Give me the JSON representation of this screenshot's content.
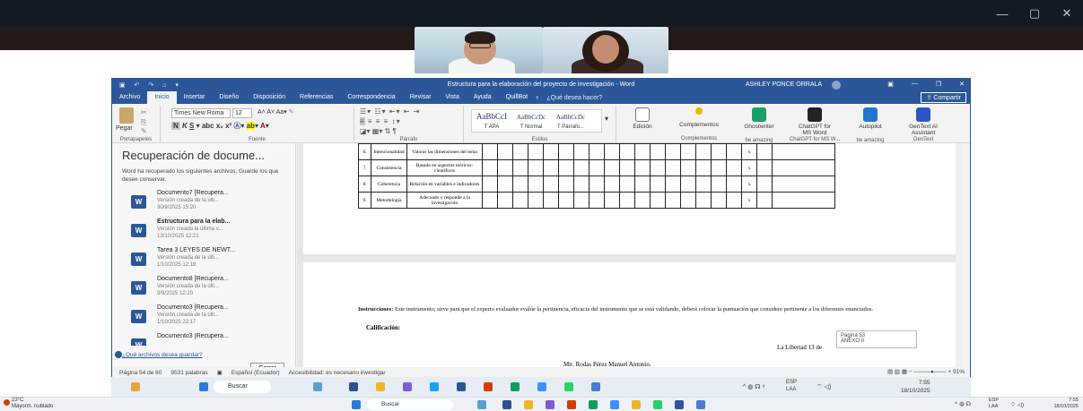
{
  "meeting": {
    "window_controls": [
      "—",
      "▢",
      "✕"
    ]
  },
  "word": {
    "title": "Estructura para la elaboración del proyecto de investigación  -  Word",
    "user": "ASHLEY PONCE ORRALA",
    "user_initials": "AP",
    "tabs": [
      "Archivo",
      "Inicio",
      "Insertar",
      "Diseño",
      "Disposición",
      "Referencias",
      "Correspondencia",
      "Revisar",
      "Vista",
      "Ayuda",
      "QuillBot"
    ],
    "active_tab": "Inicio",
    "tell_me": "¿Qué desea hacer?",
    "share": "Compartir",
    "ribbon": {
      "paste": "Pegar",
      "font_name": "Times New Roma",
      "font_size": "12",
      "groups": [
        "Portapapeles",
        "Fuente",
        "Párrafo",
        "Estilos",
        "Complementos",
        "be amazing",
        "ChatGPT for MS W...",
        "be amazing",
        "GenText"
      ],
      "styles": [
        {
          "preview": "AaBbCcI",
          "name": "T APA"
        },
        {
          "preview": "AaBbCcDc",
          "name": "T Normal"
        },
        {
          "preview": "AaBbCcDc",
          "name": "T Párrafo..."
        }
      ],
      "edicion": "Edición",
      "complementos": "Complementos",
      "addins": [
        "Ghostwriter",
        "ChatGPT for MS Word",
        "Autopilot",
        "GenText AI Assistant"
      ]
    },
    "recovery": {
      "title": "Recuperación de docume...",
      "intro": "Word ha recuperado los siguientes archivos. Guarde los que desee conservar.",
      "files": [
        {
          "name": "Documento7 [Recupera...",
          "line1": "Versión creada de la últi...",
          "line2": "30/9/2025 15:20"
        },
        {
          "name": "Estructura para la elab...",
          "line1": "Versión creada la última v...",
          "line2": "13/10/2025 12:21"
        },
        {
          "name": "Tarea 3 LEYES DE NEWT...",
          "line1": "Versión creada de la últi...",
          "line2": "1/10/2025 12:18"
        },
        {
          "name": "Documento8 [Recupera...",
          "line1": "Versión creada de la últi...",
          "line2": "9/9/2025 12:20"
        },
        {
          "name": "Documento3 [Recupera...",
          "line1": "Versión creada de la últi...",
          "line2": "1/10/2025 22:17"
        },
        {
          "name": "Documento3 [Recupera...",
          "line1": "",
          "line2": ""
        }
      ],
      "question": "¿Qué archivos desea guardar?",
      "close": "Cerrar"
    },
    "table_rows": [
      {
        "num": "6.",
        "name": "Intencionalidad",
        "desc": "Valorar las dimensiones del tema",
        "mark": "x"
      },
      {
        "num": "7.",
        "name": "Consistencia",
        "desc": "Basado en aspectos teóricos-científicos",
        "mark": "x"
      },
      {
        "num": "8.",
        "name": "Coherencia",
        "desc": "Relación en variables e indicadores",
        "mark": "x"
      },
      {
        "num": "9.",
        "name": "Metodología",
        "desc": "Adecuado y responde a la investigación",
        "mark": "x"
      }
    ],
    "instructions_label": "Instrucciones:",
    "instructions": "Este instrumento, sirve para que el experto evaluador evalúe la pertinencia, eficacia del instrumento que se está validando, deberá colocar la puntuación que considere pertinente a los diferentes enunciados.",
    "calificacion": "Calificación:",
    "tooltip_line1": "Página 53",
    "tooltip_line2": "ANEXO II",
    "place_date": "La Libertad 13 de",
    "signature": "Mtr. Rodas Pérez Manuel Antonio.",
    "status": {
      "page": "Página 54 de 60",
      "words": "9531 palabras",
      "language": "Español (Ecuador)",
      "accessibility": "Accesibilidad: es necesario investigar",
      "zoom": "91%"
    }
  },
  "inner_taskbar": {
    "search": "Buscar",
    "lang": "ESP",
    "lang2": "LAA",
    "time": "7:55",
    "date": "18/10/2025"
  },
  "taskbar": {
    "weather": "23°C",
    "weather_desc": "Mayorm. nublado",
    "search": "Buscar",
    "lang": "ESP",
    "lang2": "LAA",
    "time": "7:55",
    "date": "18/10/2025"
  },
  "colors": {
    "word_blue": "#2b579a",
    "dark_band": "#231a17"
  }
}
